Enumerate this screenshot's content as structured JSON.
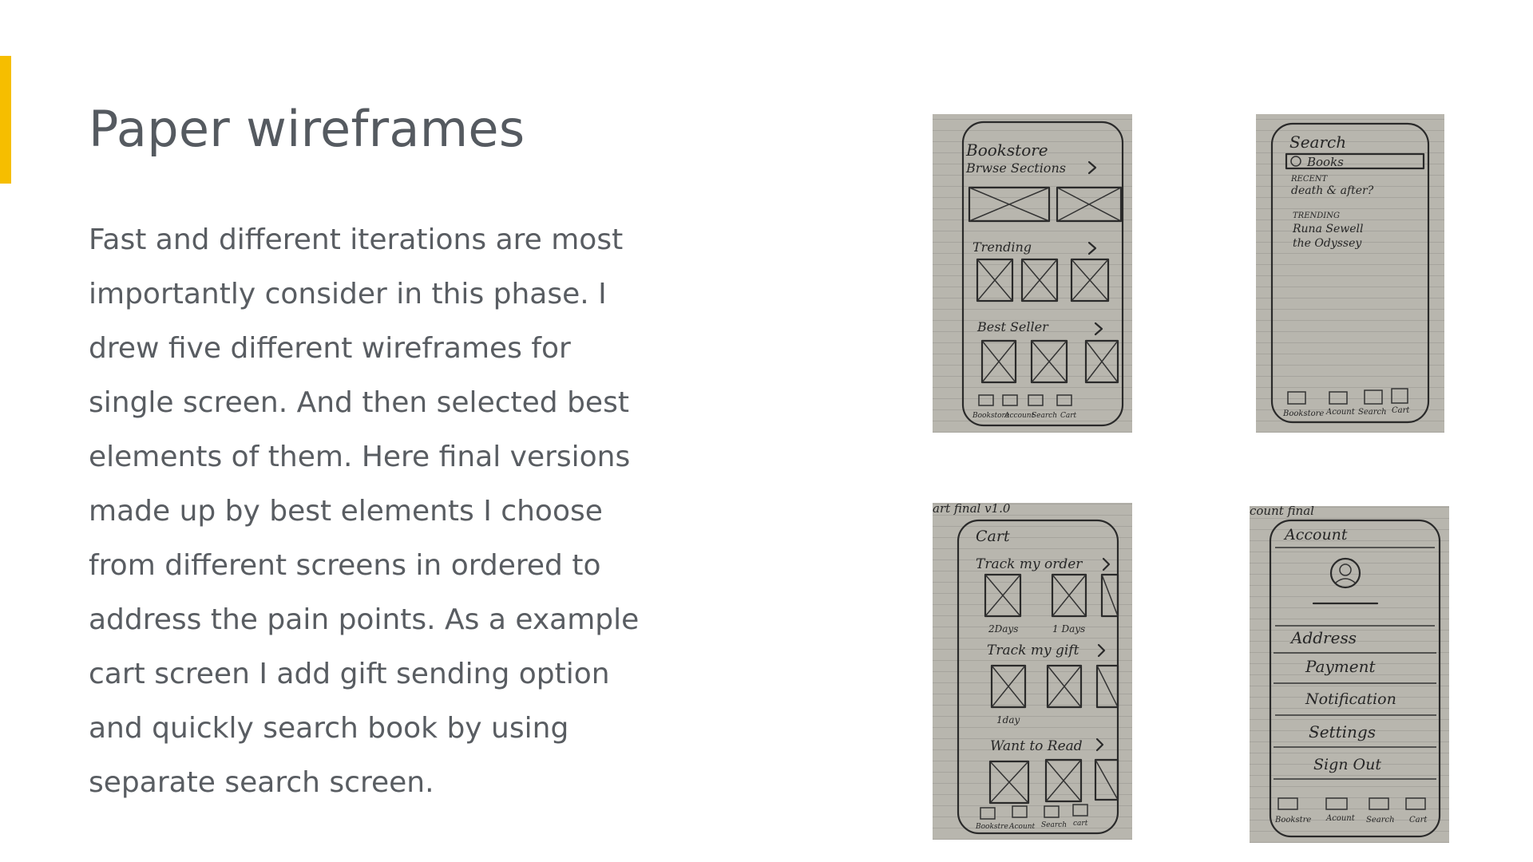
{
  "slide": {
    "title": "Paper wireframes",
    "body": "Fast and different iterations are most importantly consider in this phase. I drew five different wireframes for single screen. And then selected best elements of them. Here final versions made up by best elements I choose from different screens in ordered to address the pain points. As a example cart screen I add gift sending option and quickly search book by using separate search screen.",
    "accent_color": "#F6BE00"
  },
  "sketches": {
    "bookstore": {
      "header": "Bookstore",
      "sections": [
        "Brwse Sections",
        "Trending",
        "Best Seller"
      ],
      "nav": [
        "Bookstore",
        "Account",
        "Search",
        "Cart"
      ]
    },
    "search": {
      "header": "Search",
      "search_value": "Books",
      "recent_label": "RECENT",
      "recent_items": [
        "death & after?"
      ],
      "trending_label": "TRENDING",
      "trending_items": [
        "Runa Sewell",
        "the Odyssey"
      ],
      "nav": [
        "Bookstore",
        "Acount",
        "Search",
        "Cart"
      ]
    },
    "cart": {
      "top_note": "art final v1.0",
      "header": "Cart",
      "sections": [
        "Track my order",
        "Track my gift",
        "Want to Read"
      ],
      "captions": [
        "2Days",
        "1 Days",
        "1day"
      ],
      "nav": [
        "Bookstre",
        "Acount",
        "Search",
        "cart"
      ]
    },
    "account": {
      "top_note": "count final",
      "header": "Account",
      "menu": [
        "Address",
        "Payment",
        "Notification",
        "Settings",
        "Sign Out"
      ],
      "nav": [
        "Bookstre",
        "Acount",
        "Search",
        "Cart"
      ]
    }
  }
}
